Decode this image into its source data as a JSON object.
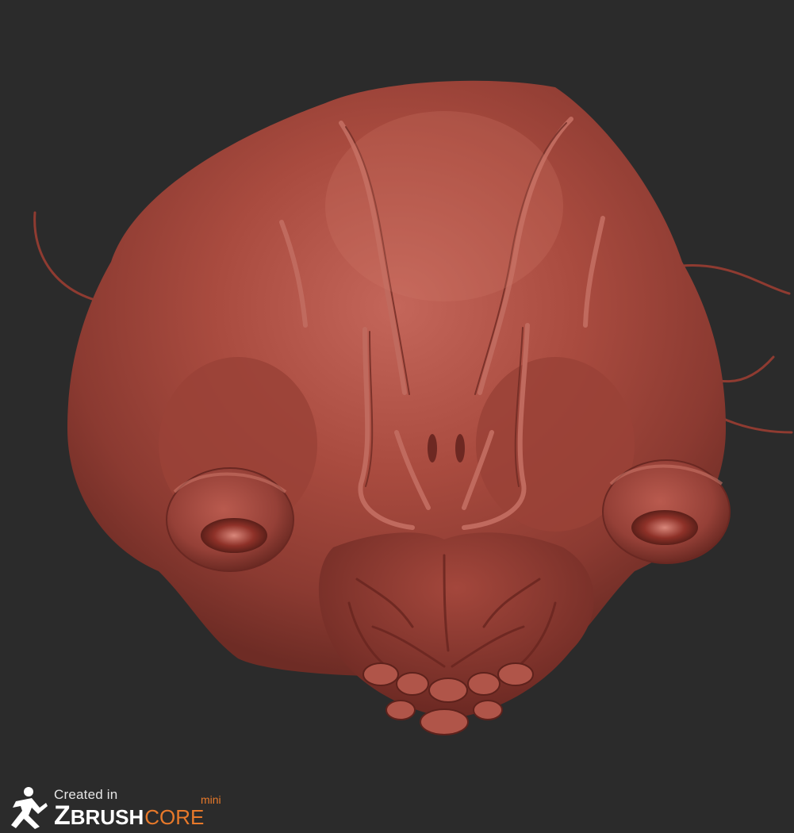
{
  "viewport": {
    "background_color": "#2b2b2b",
    "model_color": "#a4453a",
    "subject": "sculpted-creature-head"
  },
  "watermark": {
    "created_in": "Created in",
    "brand_z": "Z",
    "brand_brush": "BRUSH",
    "brand_core": "CORE",
    "brand_mini": "mini",
    "accent_color": "#e8792a",
    "icon": "running-figure-icon"
  }
}
